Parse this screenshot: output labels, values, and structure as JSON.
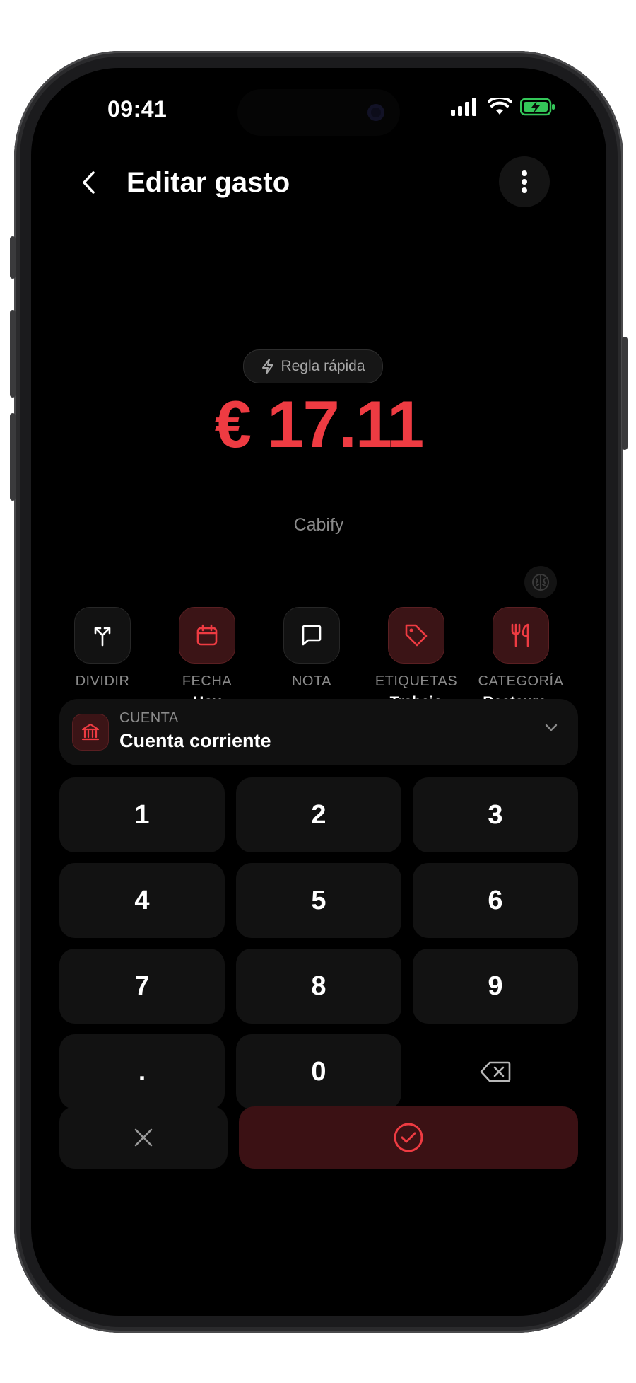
{
  "status_bar": {
    "time": "09:41"
  },
  "header": {
    "title": "Editar gasto"
  },
  "rule_chip": {
    "label": "Regla rápida"
  },
  "amount": {
    "currency": "€",
    "value": "17.11",
    "display": "€ 17.11",
    "color": "#ee3b42"
  },
  "payee": "Cabify",
  "actions": [
    {
      "label": "DIVIDIR",
      "value": "",
      "icon": "split-icon"
    },
    {
      "label": "FECHA",
      "value": "Hoy",
      "icon": "calendar-icon"
    },
    {
      "label": "NOTA",
      "value": "",
      "icon": "note-icon"
    },
    {
      "label": "ETIQUETAS",
      "value": "Trabajo",
      "icon": "tag-icon"
    },
    {
      "label": "CATEGORÍA",
      "value": "Restaura...",
      "icon": "restaurant-icon"
    }
  ],
  "account": {
    "label": "CUENTA",
    "value": "Cuenta corriente",
    "icon": "bank-icon"
  },
  "keypad": {
    "keys": [
      "1",
      "2",
      "3",
      "4",
      "5",
      "6",
      "7",
      "8",
      "9",
      ".",
      "0"
    ],
    "backspace_icon": "backspace-icon",
    "cancel_icon": "close-icon",
    "confirm_icon": "check-circle-icon"
  },
  "colors": {
    "accent": "#ee3b42",
    "battery": "#34c759"
  }
}
